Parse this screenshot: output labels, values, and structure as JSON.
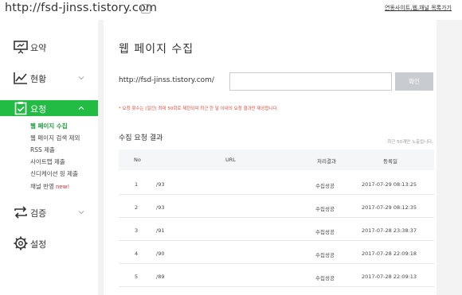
{
  "header": {
    "site_url": "http://fsd-jinss.tistory.com",
    "link_label": "연동사이트,웹,채널 목록가기"
  },
  "sidebar": {
    "items": [
      {
        "label": "요약",
        "icon": "presentation-board-icon"
      },
      {
        "label": "현황",
        "icon": "line-chart-icon"
      },
      {
        "label": "요청",
        "icon": "clipboard-check-icon",
        "active": true
      },
      {
        "label": "검증",
        "icon": "sync-arrows-icon"
      },
      {
        "label": "설정",
        "icon": "gear-icon"
      }
    ],
    "subitems": [
      {
        "label": "웹 페이지 수집",
        "current": true
      },
      {
        "label": "웹 페이지 검색 제외"
      },
      {
        "label": "RSS 제출"
      },
      {
        "label": "사이트맵 제출"
      },
      {
        "label": "신디케이션 핑 제출"
      },
      {
        "label": "채널 반영",
        "badge": "new!"
      }
    ]
  },
  "main": {
    "title": "웹 페이지 수집",
    "url_prefix": "http://fsd-jinss.tistory.com/",
    "input_value": "",
    "submit_label": "확인",
    "notice": "* 요청 횟수는 (일간) 최대 50회로 제한되며 최근 한 달 이내의 요청 결과만 제공합니다.",
    "results_title": "수집 요청 결과",
    "results_note": "최근 50개만 노출됩니다.",
    "columns": [
      "No",
      "URL",
      "처리결과",
      "등록일"
    ],
    "rows": [
      {
        "no": "1",
        "url": "/93",
        "status": "수집성공",
        "date": "2017-07-29 08:13:25"
      },
      {
        "no": "2",
        "url": "/93",
        "status": "수집성공",
        "date": "2017-07-29 08:12:35"
      },
      {
        "no": "3",
        "url": "/91",
        "status": "수집성공",
        "date": "2017-07-28 23:38:37"
      },
      {
        "no": "4",
        "url": "/90",
        "status": "수집성공",
        "date": "2017-07-28 22:09:18"
      },
      {
        "no": "5",
        "url": "/89",
        "status": "수집성공",
        "date": "2017-07-28 22:09:13"
      }
    ]
  },
  "colors": {
    "accent_green": "#22bb44",
    "notice_red": "#e34c3c",
    "content_bg": "#f3f3f3"
  }
}
